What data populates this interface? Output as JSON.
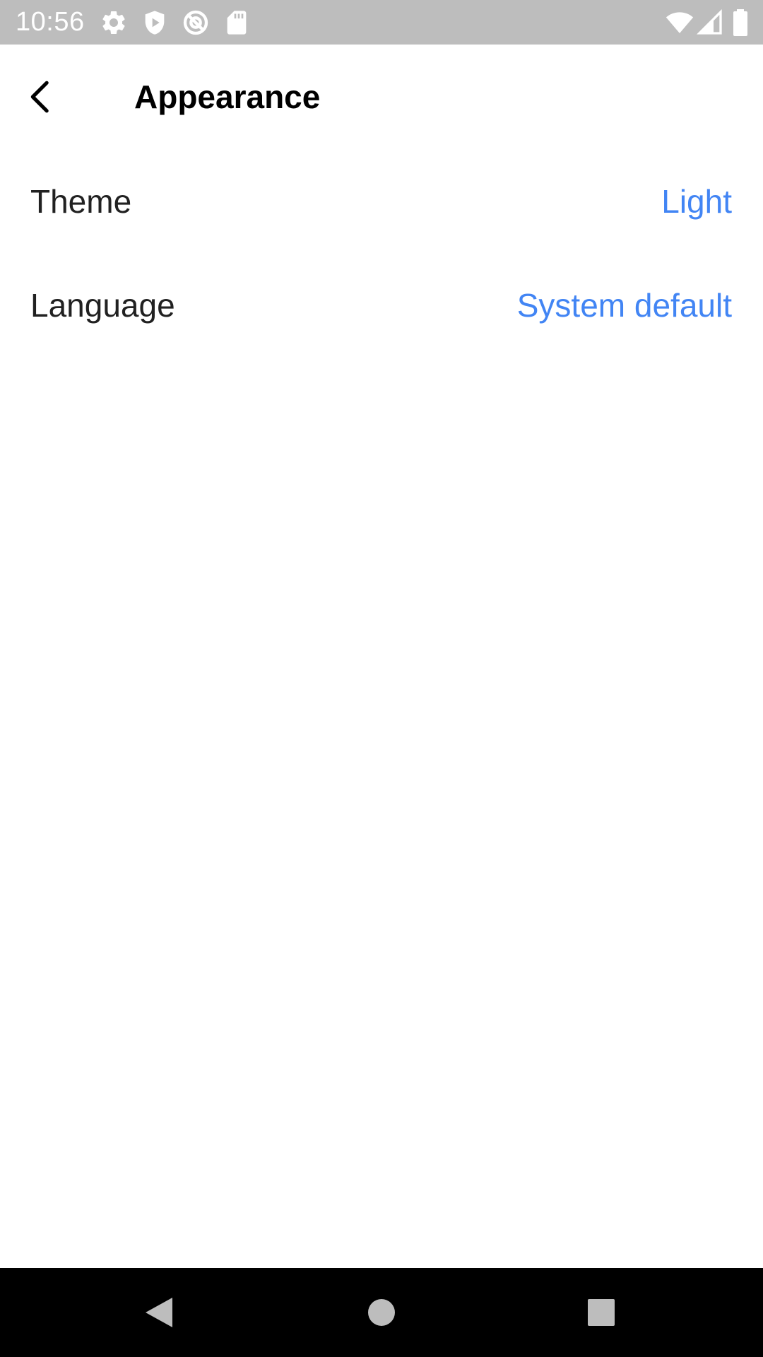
{
  "status_bar": {
    "time": "10:56",
    "background": "#bdbdbd",
    "left_icons": [
      "settings-gear-icon",
      "shield-play-icon",
      "no-sync-icon",
      "sd-card-icon"
    ],
    "right_icons": [
      "wifi-icon",
      "cell-signal-icon",
      "battery-icon"
    ]
  },
  "app_bar": {
    "back_icon": "chevron-left-icon",
    "title": "Appearance"
  },
  "settings": [
    {
      "label": "Theme",
      "value": "Light"
    },
    {
      "label": "Language",
      "value": "System default"
    }
  ],
  "colors": {
    "accent": "#4285f4",
    "label": "#212121",
    "title": "#000000",
    "nav_bar": "#000000"
  },
  "nav_bar": {
    "buttons": [
      "back-triangle-icon",
      "home-circle-icon",
      "recents-square-icon"
    ]
  }
}
